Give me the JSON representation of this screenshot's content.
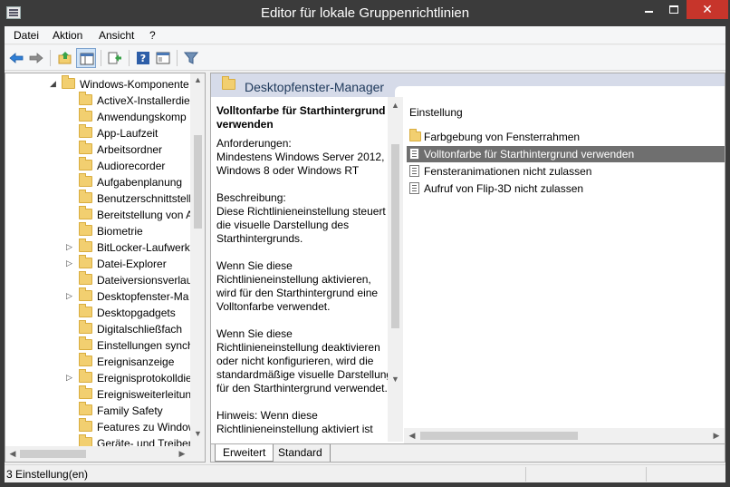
{
  "window": {
    "title": "Editor für lokale Gruppenrichtlinien",
    "close_glyph": "✕"
  },
  "menu": [
    "Datei",
    "Aktion",
    "Ansicht",
    "?"
  ],
  "toolbar_icons": [
    "back-arrow-icon",
    "forward-arrow-icon",
    "up-folder-icon",
    "show-hide-tree-icon",
    "export-list-icon",
    "help-icon",
    "properties-icon",
    "filter-icon"
  ],
  "tree": {
    "items": [
      {
        "label": "Windows-Komponente",
        "expanded": true,
        "expander": "◢"
      },
      {
        "label": "ActiveX-Installerdie",
        "expander": ""
      },
      {
        "label": "Anwendungskomp",
        "expander": ""
      },
      {
        "label": "App-Laufzeit",
        "expander": ""
      },
      {
        "label": "Arbeitsordner",
        "expander": ""
      },
      {
        "label": "Audiorecorder",
        "expander": ""
      },
      {
        "label": "Aufgabenplanung",
        "expander": ""
      },
      {
        "label": "Benutzerschnittstell",
        "expander": ""
      },
      {
        "label": "Bereitstellung von A",
        "expander": ""
      },
      {
        "label": "Biometrie",
        "expander": ""
      },
      {
        "label": "BitLocker-Laufwerk",
        "expander": "▷"
      },
      {
        "label": "Datei-Explorer",
        "expander": "▷"
      },
      {
        "label": "Dateiversionsverlau",
        "expander": ""
      },
      {
        "label": "Desktopfenster-Ma",
        "expander": "▷"
      },
      {
        "label": "Desktopgadgets",
        "expander": ""
      },
      {
        "label": "Digitalschließfach",
        "expander": ""
      },
      {
        "label": "Einstellungen synch",
        "expander": ""
      },
      {
        "label": "Ereignisanzeige",
        "expander": ""
      },
      {
        "label": "Ereignisprotokolldie",
        "expander": "▷"
      },
      {
        "label": "Ereignisweiterleitun",
        "expander": ""
      },
      {
        "label": "Family Safety",
        "expander": ""
      },
      {
        "label": "Features zu Window",
        "expander": ""
      },
      {
        "label": "Geräte- und Treiber",
        "expander": ""
      }
    ]
  },
  "scroll_arrows": {
    "up": "▲",
    "down": "▼",
    "left": "◀",
    "right": "▶"
  },
  "details": {
    "header": "Desktopfenster-Manager",
    "title": "Volltonfarbe für Starthintergrund verwenden",
    "body": "Anforderungen:\nMindestens Windows Server 2012, Windows 8 oder Windows RT\n\nBeschreibung:\nDiese Richtlinieneinstellung steuert die visuelle Darstellung des Starthintergrunds.\n\nWenn Sie diese Richtlinieneinstellung aktivieren, wird für den Starthintergrund eine Volltonfarbe verwendet.\n\nWenn Sie diese Richtlinieneinstellung deaktivieren oder nicht konfigurieren, wird die standardmäßige visuelle Darstellung für den Starthintergrund verwendet.\n\nHinweis: Wenn diese Richtlinieneinstellung aktiviert ist"
  },
  "list": {
    "column": "Einstellung",
    "rows": [
      {
        "label": "Farbgebung von Fensterrahmen",
        "type": "folder"
      },
      {
        "label": "Volltonfarbe für Starthintergrund verwenden",
        "type": "policy",
        "selected": true
      },
      {
        "label": "Fensteranimationen nicht zulassen",
        "type": "policy"
      },
      {
        "label": "Aufruf von Flip-3D nicht zulassen",
        "type": "policy"
      }
    ]
  },
  "tabs": [
    "Erweitert",
    "Standard"
  ],
  "status": {
    "text": "3 Einstellung(en)"
  },
  "colors": {
    "titlebar": "#3b3b3b",
    "close": "#c7352b",
    "header": "#d6dbe9",
    "selection": "#6f6f6f"
  }
}
